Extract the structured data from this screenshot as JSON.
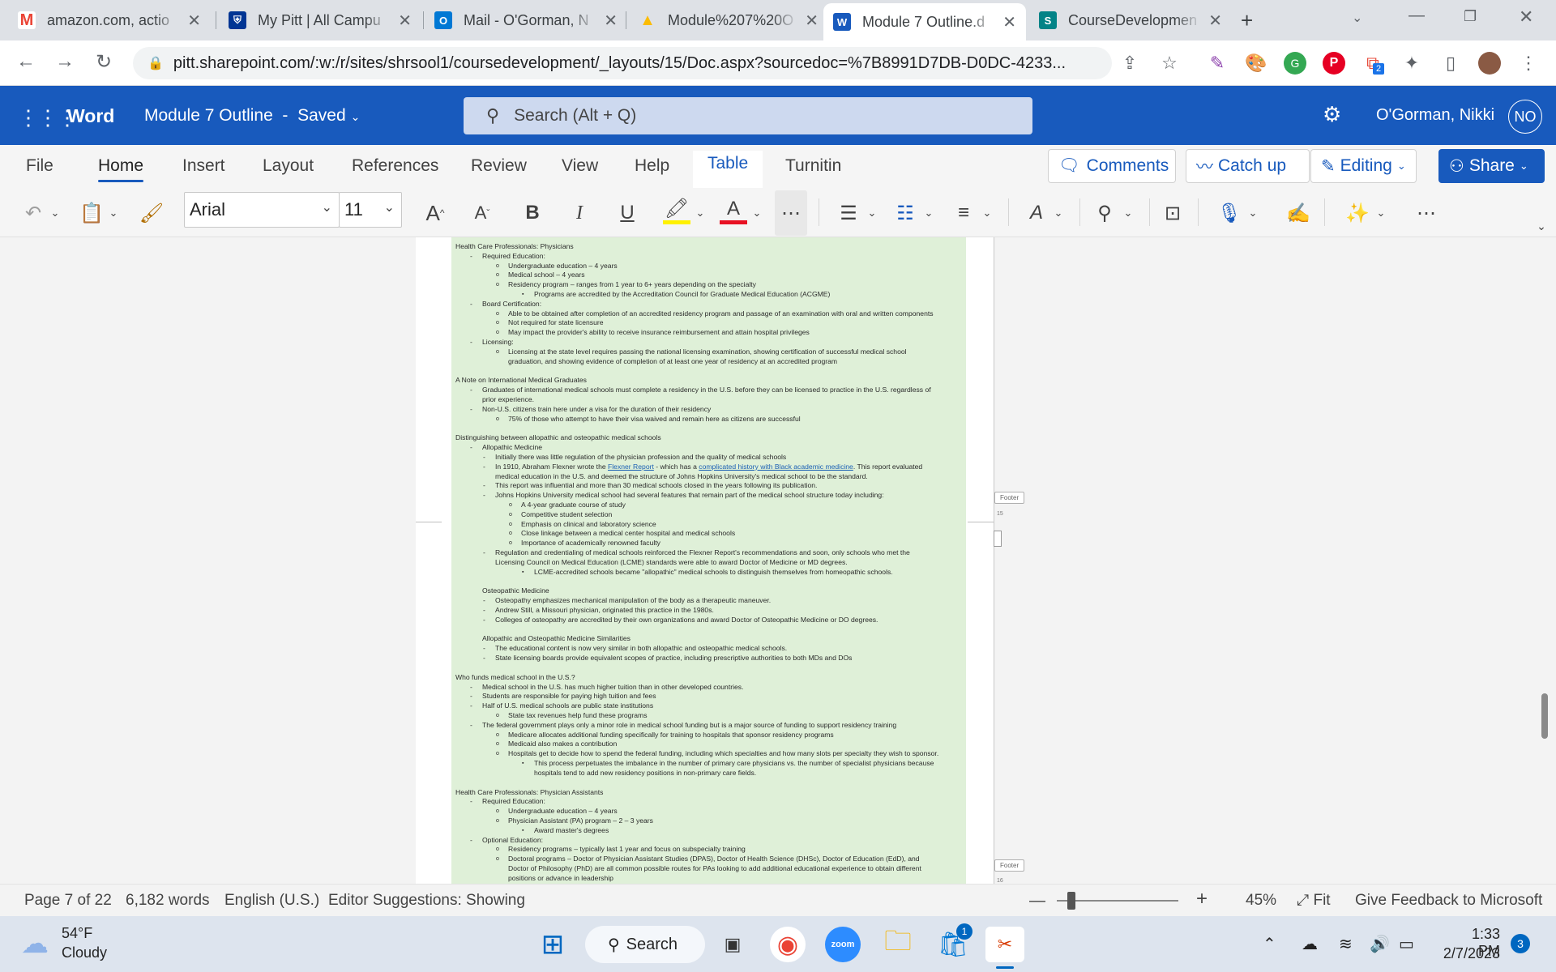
{
  "browser": {
    "tabs": [
      {
        "title": "amazon.com, actio",
        "icon": "gmail-icon",
        "color": "#ea4335",
        "glyph": "M"
      },
      {
        "title": "My Pitt | All Campu",
        "icon": "pitt-shield-icon",
        "color": "#003594",
        "glyph": "P"
      },
      {
        "title": "Mail - O'Gorman, N",
        "icon": "outlook-icon",
        "color": "#0078d4",
        "glyph": "O"
      },
      {
        "title": "Module%207%20O",
        "icon": "google-drive-icon",
        "color": "#34a853",
        "glyph": "▲"
      },
      {
        "title": "Module 7 Outline.d",
        "icon": "word-icon",
        "color": "#185abd",
        "glyph": "W"
      },
      {
        "title": "CourseDevelopmen",
        "icon": "sharepoint-icon",
        "color": "#038387",
        "glyph": "S"
      }
    ],
    "new_tab": "+",
    "url": "pitt.sharepoint.com/:w:/r/sites/shrsool1/coursedevelopment/_layouts/15/Doc.aspx?sourcedoc=%7B8991D7DB-D0DC-4233...",
    "ext_badge": "2"
  },
  "word": {
    "app_name": "Word",
    "doc_title": "Module 7 Outline",
    "save_state": "Saved",
    "search_placeholder": "Search (Alt + Q)",
    "user_name": "O'Gorman, Nikki",
    "user_initials": "NO"
  },
  "ribbon": {
    "tabs": [
      "File",
      "Home",
      "Insert",
      "Layout",
      "References",
      "Review",
      "View",
      "Help",
      "Table",
      "Turnitin"
    ],
    "comments": "Comments",
    "catch_up": "Catch up",
    "editing": "Editing",
    "share": "Share",
    "font": "Arial",
    "font_size": "11"
  },
  "document": {
    "lines": [
      {
        "c": "h",
        "t": "Health Care Professionals: Physicians"
      },
      {
        "c": "i1",
        "t": "Required Education:"
      },
      {
        "c": "i2",
        "t": "Undergraduate education – 4 years"
      },
      {
        "c": "i2",
        "t": "Medical school – 4 years"
      },
      {
        "c": "i2",
        "t": "Residency program – ranges from 1 year to 6+ years depending on the specialty"
      },
      {
        "c": "i3",
        "t": "Programs are accredited by the Accreditation Council for Graduate Medical Education (ACGME)"
      },
      {
        "c": "i1",
        "t": "Board Certification:"
      },
      {
        "c": "i2",
        "t": "Able to be obtained after completion of an accredited residency program and passage of an examination with oral and written components"
      },
      {
        "c": "i2",
        "t": "Not required for state licensure"
      },
      {
        "c": "i2",
        "t": "May impact the provider's ability to receive insurance reimbursement and attain hospital privileges"
      },
      {
        "c": "i1",
        "t": "Licensing:"
      },
      {
        "c": "i2",
        "t": "Licensing at the state level requires passing the national licensing examination, showing certification of successful medical school"
      },
      {
        "c": "c2",
        "t": "graduation, and showing evidence of completion of at least one year of residency at an accredited program"
      },
      {
        "c": "gap",
        "t": ""
      },
      {
        "c": "h",
        "t": "A Note on International Medical Graduates"
      },
      {
        "c": "i1",
        "t": "Graduates of international medical schools must complete a residency in the U.S. before they can be licensed to practice in the U.S. regardless of"
      },
      {
        "c": "c1",
        "t": "prior experience."
      },
      {
        "c": "i1",
        "t": "Non-U.S. citizens train here under a visa for the duration of their residency"
      },
      {
        "c": "i2",
        "t": "75% of those who attempt to have their visa waived and remain here as citizens are successful"
      },
      {
        "c": "gap",
        "t": ""
      },
      {
        "c": "h",
        "t": "Distinguishing between allopathic and osteopathic medical schools"
      },
      {
        "c": "i1",
        "t": "Allopathic Medicine"
      },
      {
        "c": "i2b",
        "t": "Initially there was little regulation of the physician profession and the quality of medical schools"
      },
      {
        "c": "i2b",
        "t": "In 1910, Abraham Flexner wrote the ",
        "link1": "Flexner Report",
        "mid": " - which has a ",
        "link2": "complicated history with Black academic medicine",
        "tail": ". This report evaluated"
      },
      {
        "c": "c2b",
        "t": "medical education in the U.S. and deemed the structure of Johns Hopkins University's medical school to be the standard."
      },
      {
        "c": "i2b",
        "t": "This report was influential and more than 30 medical schools closed in the years following its publication."
      },
      {
        "c": "i2b",
        "t": "Johns Hopkins University medical school had several features that remain part of the medical school structure today including:"
      },
      {
        "c": "i3b",
        "t": "A 4-year graduate course of study"
      },
      {
        "c": "i3b",
        "t": "Competitive student selection"
      },
      {
        "c": "i3b",
        "t": "Emphasis on clinical and laboratory science"
      },
      {
        "c": "i3b",
        "t": "Close linkage between a medical center hospital and medical schools"
      },
      {
        "c": "i3b",
        "t": "Importance of academically renowned faculty"
      },
      {
        "c": "i2b",
        "t": "Regulation and credentialing of medical schools reinforced the Flexner Report's recommendations and soon, only schools who met the"
      },
      {
        "c": "c2b",
        "t": "Licensing Council on Medical Education (LCME) standards were able to award Doctor of Medicine or MD degrees."
      },
      {
        "c": "i3",
        "t": "LCME-accredited schools became \"allopathic\" medical schools to distinguish themselves from homeopathic schools."
      },
      {
        "c": "gap",
        "t": ""
      },
      {
        "c": "c1",
        "t": "Osteopathic Medicine"
      },
      {
        "c": "i2b",
        "t": "Osteopathy emphasizes mechanical manipulation of the body as a therapeutic maneuver."
      },
      {
        "c": "i2b",
        "t": "Andrew Still, a Missouri physician, originated this practice in the 1980s."
      },
      {
        "c": "i2b",
        "t": "Colleges of osteopathy are accredited by their own organizations and award Doctor of Osteopathic Medicine or DO degrees."
      },
      {
        "c": "gap",
        "t": ""
      },
      {
        "c": "c1",
        "t": "Allopathic and Osteopathic Medicine Similarities"
      },
      {
        "c": "i2b",
        "t": "The educational content is now very similar in both allopathic and osteopathic medical schools."
      },
      {
        "c": "i2b",
        "t": "State licensing boards provide equivalent scopes of practice, including prescriptive authorities to both MDs and DOs"
      },
      {
        "c": "gap",
        "t": ""
      },
      {
        "c": "h",
        "t": "Who funds medical school in the U.S.?"
      },
      {
        "c": "i1",
        "t": "Medical school in the U.S. has much higher tuition than in other developed countries."
      },
      {
        "c": "i1",
        "t": "Students are responsible for paying high tuition and fees"
      },
      {
        "c": "i1",
        "t": "Half of U.S. medical schools are public state institutions"
      },
      {
        "c": "i2",
        "t": "State tax revenues help fund these programs"
      },
      {
        "c": "i1",
        "t": "The federal government plays only a minor role in medical school funding but is a major source of funding to support residency training"
      },
      {
        "c": "i2",
        "t": "Medicare allocates additional funding specifically for training to hospitals that sponsor residency programs"
      },
      {
        "c": "i2",
        "t": "Medicaid also makes a contribution"
      },
      {
        "c": "i2",
        "t": "Hospitals get to decide how to spend the federal funding, including which specialties and how many slots per specialty they wish to sponsor."
      },
      {
        "c": "i3",
        "t": "This process perpetuates the imbalance in the number of primary care physicians vs. the number of specialist physicians because"
      },
      {
        "c": "c3",
        "t": "hospitals tend to add new residency positions in non-primary care fields."
      },
      {
        "c": "gap",
        "t": ""
      },
      {
        "c": "h",
        "t": "Health Care Professionals: Physician Assistants"
      },
      {
        "c": "i1",
        "t": "Required Education:"
      },
      {
        "c": "i2",
        "t": "Undergraduate education – 4 years"
      },
      {
        "c": "i2",
        "t": "Physician Assistant (PA) program – 2 – 3 years"
      },
      {
        "c": "i3",
        "t": "Award master's degrees"
      },
      {
        "c": "i1",
        "t": "Optional Education:"
      },
      {
        "c": "i2",
        "t": "Residency programs – typically last 1 year and focus on subspecialty training"
      },
      {
        "c": "i2",
        "t": "Doctoral programs – Doctor of Physician Assistant Studies (DPAS), Doctor of Health Science (DHSc), Doctor of Education (EdD), and"
      },
      {
        "c": "c2",
        "t": "Doctor of Philosophy (PhD) are all common possible routes for PAs looking to add additional educational experience to obtain different"
      },
      {
        "c": "c2",
        "t": "positions or advance in leadership"
      }
    ],
    "footer_label": "Footer",
    "page_15": "15",
    "page_16": "16"
  },
  "status_bar": {
    "page": "Page 7 of 22",
    "words": "6,182 words",
    "language": "English (U.S.)",
    "editor": "Editor Suggestions: Showing",
    "zoom": "45%",
    "fit": "Fit",
    "feedback": "Give Feedback to Microsoft"
  },
  "taskbar": {
    "temp": "54°F",
    "weather": "Cloudy",
    "search": "Search",
    "time": "1:33 PM",
    "date": "2/7/2023",
    "notif_count": "3",
    "store_badge": "1"
  }
}
